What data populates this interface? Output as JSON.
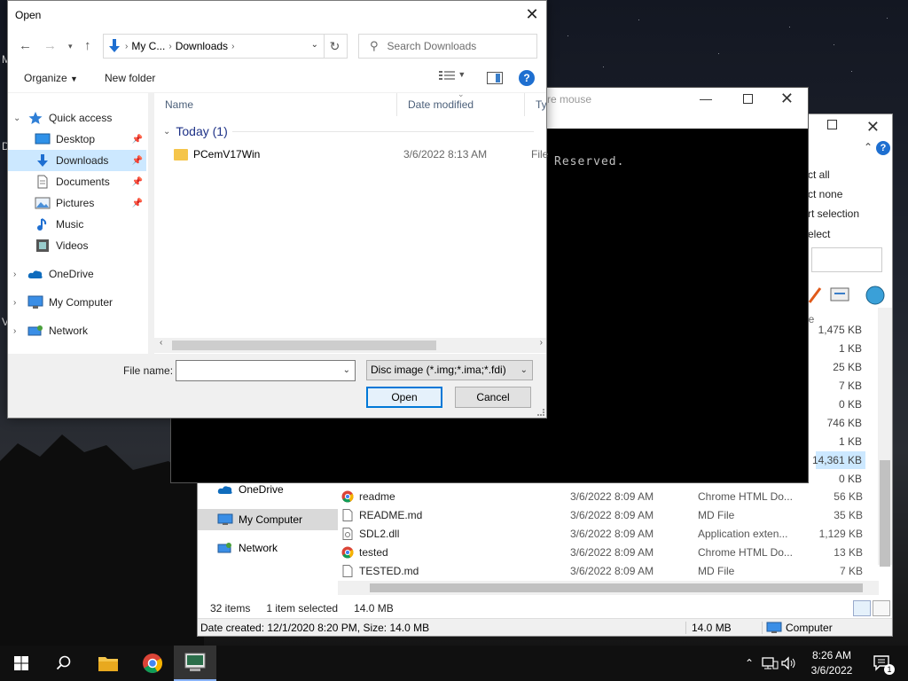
{
  "dialog": {
    "title": "Open",
    "address": {
      "crumbs": [
        "My C...",
        "Downloads"
      ]
    },
    "search_placeholder": "Search Downloads",
    "commands": {
      "organize": "Organize",
      "new_folder": "New folder"
    },
    "help_glyph": "?",
    "nav": {
      "quick_access": "Quick access",
      "items": [
        {
          "label": "Desktop",
          "icon": "desktop-icon"
        },
        {
          "label": "Downloads",
          "icon": "download-icon"
        },
        {
          "label": "Documents",
          "icon": "document-icon"
        },
        {
          "label": "Pictures",
          "icon": "picture-icon"
        },
        {
          "label": "Music",
          "icon": "music-icon"
        },
        {
          "label": "Videos",
          "icon": "video-icon"
        }
      ],
      "onedrive": "OneDrive",
      "my_computer": "My Computer",
      "network": "Network"
    },
    "columns": {
      "name": "Name",
      "date_modified": "Date modified",
      "type": "Type"
    },
    "group": "Today (1)",
    "files": [
      {
        "name": "PCemV17Win",
        "date": "3/6/2022 8:13 AM",
        "type": "File fo"
      }
    ],
    "file_name_label": "File name:",
    "file_name_value": "",
    "filter": "Disc image (*.img;*.ima;*.fdi)",
    "open_button": "Open",
    "cancel_button": "Cancel"
  },
  "console": {
    "title_fragment": "re mouse",
    "text": "Reserved."
  },
  "explorer": {
    "ribbon": [
      "ct all",
      "ct none",
      "rt selection",
      "elect"
    ],
    "size_header": "ize",
    "sizes": [
      "1,475 KB",
      "1 KB",
      "25 KB",
      "7 KB",
      "0 KB",
      "746 KB",
      "1 KB",
      "14,361 KB",
      "0 KB"
    ],
    "nav": {
      "onedrive": "OneDrive",
      "my_computer": "My Computer",
      "network": "Network"
    },
    "files": [
      {
        "name": "readme",
        "date": "3/6/2022 8:09 AM",
        "type": "Chrome HTML Do...",
        "size": "56 KB",
        "icon": "chrome-icon"
      },
      {
        "name": "README.md",
        "date": "3/6/2022 8:09 AM",
        "type": "MD File",
        "size": "35 KB",
        "icon": "file-icon"
      },
      {
        "name": "SDL2.dll",
        "date": "3/6/2022 8:09 AM",
        "type": "Application exten...",
        "size": "1,129 KB",
        "icon": "dll-icon"
      },
      {
        "name": "tested",
        "date": "3/6/2022 8:09 AM",
        "type": "Chrome HTML Do...",
        "size": "13 KB",
        "icon": "chrome-icon"
      },
      {
        "name": "TESTED.md",
        "date": "3/6/2022 8:09 AM",
        "type": "MD File",
        "size": "7 KB",
        "icon": "file-icon"
      }
    ],
    "status": {
      "items": "32 items",
      "selected": "1 item selected",
      "size": "14.0 MB"
    },
    "details": {
      "created": "Date created: 12/1/2020 8:20 PM, Size: 14.0 MB",
      "size": "14.0 MB",
      "location": "Computer"
    }
  },
  "desktop_letters": [
    "M",
    "D",
    "V"
  ],
  "taskbar": {
    "time": "8:26 AM",
    "date": "3/6/2022",
    "notification_count": "1"
  }
}
